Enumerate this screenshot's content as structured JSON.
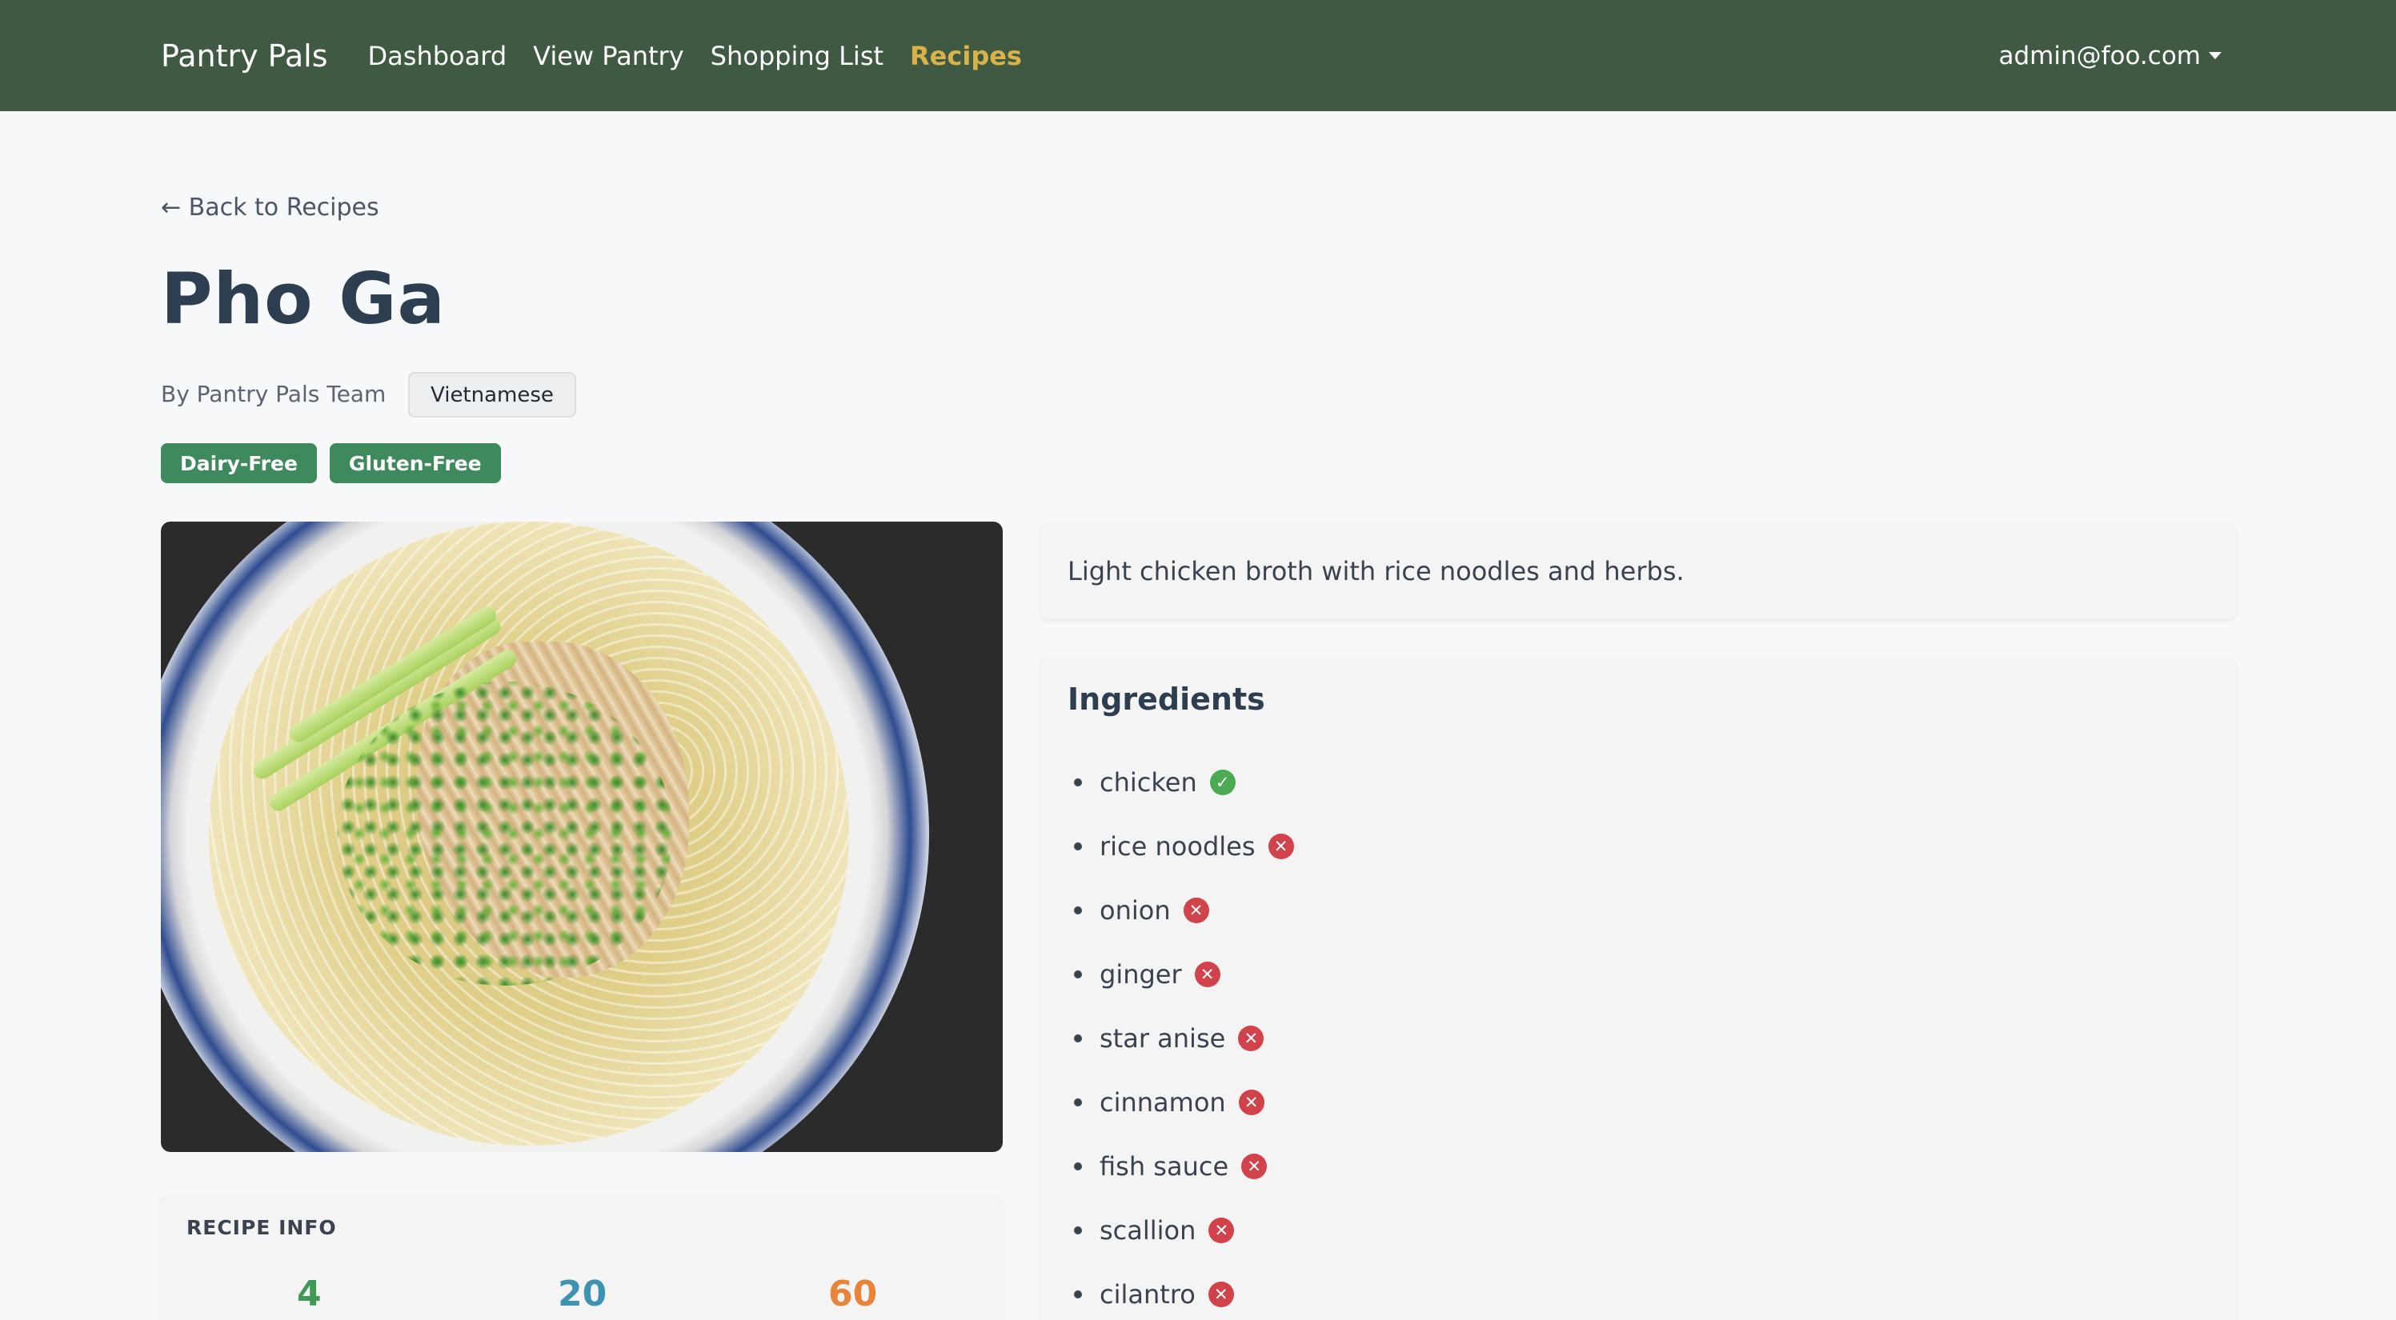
{
  "navbar": {
    "brand": "Pantry Pals",
    "links": [
      {
        "label": "Dashboard",
        "active": false
      },
      {
        "label": "View Pantry",
        "active": false
      },
      {
        "label": "Shopping List",
        "active": false
      },
      {
        "label": "Recipes",
        "active": true
      }
    ],
    "user_email": "admin@foo.com",
    "bg_color": "#405943",
    "active_color": "#d9b24a"
  },
  "back_link": "← Back to Recipes",
  "recipe": {
    "title": "Pho Ga",
    "author": "By Pantry Pals Team",
    "cuisine": "Vietnamese",
    "tags": [
      "Dairy-Free",
      "Gluten-Free"
    ],
    "description": "Light chicken broth with rice noodles and herbs.",
    "image_icon": "pho-bowl-photo"
  },
  "recipe_info": {
    "title": "RECIPE INFO",
    "stats": [
      "4",
      "20",
      "60"
    ]
  },
  "ingredients": {
    "title": "Ingredients",
    "items": [
      {
        "name": "chicken",
        "in_pantry": true
      },
      {
        "name": "rice noodles",
        "in_pantry": false
      },
      {
        "name": "onion",
        "in_pantry": false
      },
      {
        "name": "ginger",
        "in_pantry": false
      },
      {
        "name": "star anise",
        "in_pantry": false
      },
      {
        "name": "cinnamon",
        "in_pantry": false
      },
      {
        "name": "fish sauce",
        "in_pantry": false
      },
      {
        "name": "scallion",
        "in_pantry": false
      },
      {
        "name": "cilantro",
        "in_pantry": false
      }
    ],
    "have_icon": "check-circle-icon",
    "missing_icon": "x-circle-icon",
    "have_color": "#4caa55",
    "missing_color": "#d2424b"
  }
}
